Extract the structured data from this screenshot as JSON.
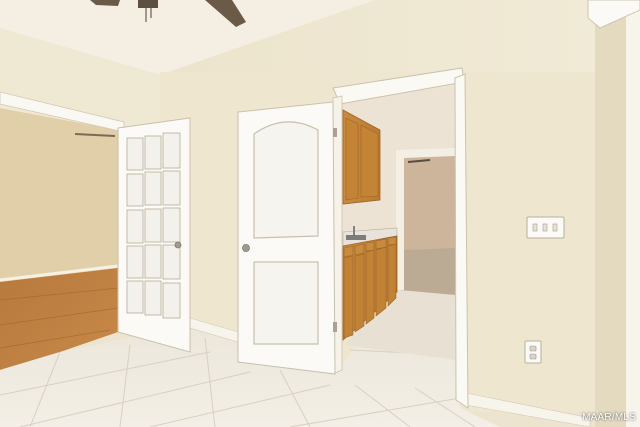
{
  "watermark": {
    "text": "MAAR/MLS"
  }
}
